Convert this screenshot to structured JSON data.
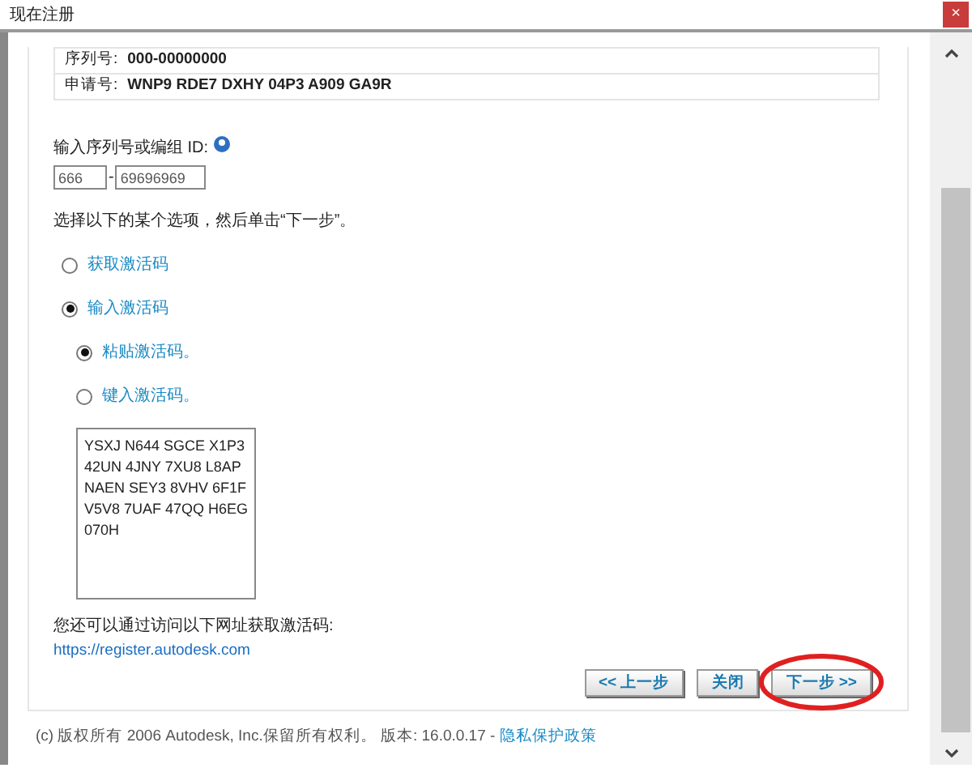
{
  "window": {
    "title": "现在注册",
    "close": "×"
  },
  "info_rows": [
    {
      "label": "序列号:",
      "value": "000-00000000"
    },
    {
      "label": "申请号:",
      "value": "WNP9 RDE7 DXHY 04P3 A909 GA9R"
    }
  ],
  "serial": {
    "label": "输入序列号或编组 ID:",
    "part_1": "666",
    "separator": "-",
    "part_2": "69696969"
  },
  "instruction": "选择以下的某个选项，然后单击“下一步”。",
  "options": [
    {
      "label": "获取激活码",
      "selected": false
    },
    {
      "label": "输入激活码",
      "selected": true,
      "children": [
        {
          "label": "粘贴激活码。",
          "selected": true
        },
        {
          "label": "键入激活码。",
          "selected": false
        }
      ]
    }
  ],
  "activation_code": [
    "YSXJ N644 SGCE X1P3",
    "42UN 4JNY 7XU8 L8AP",
    "NAEN SEY3 8VHV 6F1F",
    "V5V8 7UAF 47QQ H6EG",
    "070H"
  ],
  "visit_note": "您还可以通过访问以下网址获取激活码:",
  "link": "https://register.autodesk.com",
  "buttons": [
    {
      "label": "<< 上一步",
      "circled": false
    },
    {
      "label": "关闭",
      "circled": false
    },
    {
      "label": "下一步 >>",
      "circled": true
    }
  ],
  "footer": {
    "text": "(c) 版权所有 2006 Autodesk, Inc.保留所有权利。 版本: 16.0.0.17 -",
    "link": "隐私保护政策"
  }
}
